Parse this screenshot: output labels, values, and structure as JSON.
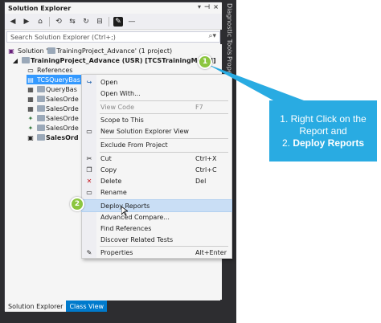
{
  "window": {
    "title": "Solution Explorer",
    "pin_glyph": "▾ ⊣ ×"
  },
  "search": {
    "placeholder": "Search Solution Explorer (Ctrl+;)"
  },
  "tree": {
    "solution_label": "Solution '",
    "solution_rest": "TrainingProject_Advance' (1 project)",
    "project_label": "TrainingProject_Advance (USR) [TCSTrainingModel]",
    "references": "References",
    "items": [
      {
        "label": "TCSQueryBas"
      },
      {
        "label": "QueryBas"
      },
      {
        "label": "SalesOrde"
      },
      {
        "label": "SalesOrde"
      },
      {
        "label": "SalesOrde"
      },
      {
        "label": "SalesOrde"
      },
      {
        "label": "SalesOrd"
      }
    ]
  },
  "context_menu": {
    "items": [
      {
        "label": "Open",
        "shortcut": ""
      },
      {
        "label": "Open With...",
        "shortcut": ""
      },
      {
        "label": "View Code",
        "shortcut": "F7"
      },
      {
        "label": "Scope to This",
        "shortcut": ""
      },
      {
        "label": "New Solution Explorer View",
        "shortcut": ""
      },
      {
        "label": "Exclude From Project",
        "shortcut": ""
      },
      {
        "label": "Cut",
        "shortcut": "Ctrl+X"
      },
      {
        "label": "Copy",
        "shortcut": "Ctrl+C"
      },
      {
        "label": "Delete",
        "shortcut": "Del"
      },
      {
        "label": "Rename",
        "shortcut": ""
      },
      {
        "label": "Deploy Reports",
        "shortcut": ""
      },
      {
        "label": "Advanced Compare...",
        "shortcut": ""
      },
      {
        "label": "Find References",
        "shortcut": ""
      },
      {
        "label": "Discover Related Tests",
        "shortcut": ""
      },
      {
        "label": "Properties",
        "shortcut": "Alt+Enter"
      }
    ]
  },
  "bottom_tabs": {
    "solution_explorer": "Solution Explorer",
    "class_view": "Class View"
  },
  "side_tabs": {
    "diagnostic": "Diagnostic Tools",
    "properties": "Properti"
  },
  "callout": {
    "badge1": "1",
    "badge2": "2",
    "line1": "1. Right Click on the",
    "line2": "Report and",
    "line3_prefix": "2. ",
    "line3_bold": "Deploy Reports"
  },
  "colors": {
    "accent": "#29abe2",
    "badge": "#8cc63f",
    "selection": "#3399ff"
  }
}
